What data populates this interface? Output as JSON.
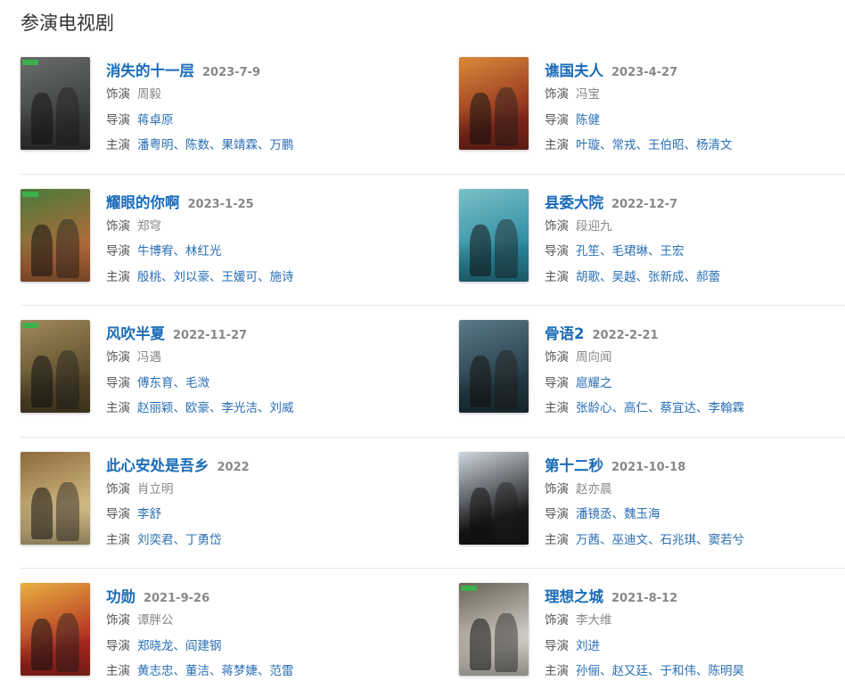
{
  "section_title": "参演电视剧",
  "labels": {
    "role": "饰演",
    "director": "导演",
    "cast": "主演"
  },
  "colors": {
    "title_link": "#1a6cb8",
    "person_link": "#2a6fb5",
    "date": "#888888",
    "divider": "#e8e8e8"
  },
  "shows": [
    {
      "title": "消失的十一层",
      "date": "2023-7-9",
      "role": "周毅",
      "directors": [
        "蒋卓原"
      ],
      "cast": [
        "潘粤明",
        "陈数",
        "果靖霖",
        "万鹏"
      ],
      "poster": {
        "bg": "#3a3d3c",
        "accent": "#6a6d6a",
        "badge": "#3cb04a"
      }
    },
    {
      "title": "谯国夫人",
      "date": "2023-4-27",
      "role": "冯宝",
      "directors": [
        "陈健"
      ],
      "cast": [
        "叶璇",
        "常戎",
        "王伯昭",
        "杨清文"
      ],
      "poster": {
        "bg": "#8a2a1c",
        "accent": "#d98a3a",
        "badge": ""
      }
    },
    {
      "title": "耀眼的你啊",
      "date": "2023-1-25",
      "role": "郑穹",
      "directors": [
        "牛博宥",
        "林红光"
      ],
      "cast": [
        "殷桃",
        "刘以豪",
        "王媛可",
        "施诗"
      ],
      "poster": {
        "bg": "#b46a3a",
        "accent": "#4a7a3a",
        "badge": "#3cb04a"
      }
    },
    {
      "title": "县委大院",
      "date": "2022-12-7",
      "role": "段迎九",
      "directors": [
        "孔笙",
        "毛珺琳",
        "王宏"
      ],
      "cast": [
        "胡歌",
        "吴越",
        "张新成",
        "郝蕾"
      ],
      "poster": {
        "bg": "#2a8aa0",
        "accent": "#7ac0c8",
        "badge": ""
      }
    },
    {
      "title": "风吹半夏",
      "date": "2022-11-27",
      "role": "冯遇",
      "directors": [
        "傅东育",
        "毛溦"
      ],
      "cast": [
        "赵丽颖",
        "欧豪",
        "李光洁",
        "刘威"
      ],
      "poster": {
        "bg": "#5a4a2a",
        "accent": "#a08a5a",
        "badge": "#3cb04a"
      }
    },
    {
      "title": "骨语2",
      "date": "2022-2-21",
      "role": "周向闻",
      "directors": [
        "扈耀之"
      ],
      "cast": [
        "张龄心",
        "高仁",
        "蔡宜达",
        "李翰霖"
      ],
      "poster": {
        "bg": "#243a44",
        "accent": "#5a7a88",
        "badge": ""
      }
    },
    {
      "title": "此心安处是吾乡",
      "date": "2022",
      "role": "肖立明",
      "directors": [
        "李舒"
      ],
      "cast": [
        "刘奕君",
        "丁勇岱"
      ],
      "poster": {
        "bg": "#d8c088",
        "accent": "#8a6a3a",
        "badge": ""
      }
    },
    {
      "title": "第十二秒",
      "date": "2021-10-18",
      "role": "赵亦晨",
      "directors": [
        "潘镜丞",
        "魏玉海"
      ],
      "cast": [
        "万茜",
        "巫迪文",
        "石兆琪",
        "窦若兮"
      ],
      "poster": {
        "bg": "#1a1a1a",
        "accent": "#cfd6e0",
        "badge": ""
      }
    },
    {
      "title": "功勋",
      "date": "2021-9-26",
      "role": "谭胖公",
      "directors": [
        "郑晓龙",
        "阎建钢"
      ],
      "cast": [
        "黄志忠",
        "董洁",
        "蒋梦婕",
        "范雷"
      ],
      "poster": {
        "bg": "#b02a22",
        "accent": "#e8b040",
        "badge": ""
      }
    },
    {
      "title": "理想之城",
      "date": "2021-8-12",
      "role": "李大维",
      "directors": [
        "刘进"
      ],
      "cast": [
        "孙俪",
        "赵又廷",
        "于和伟",
        "陈明昊"
      ],
      "poster": {
        "bg": "#d8d4cc",
        "accent": "#6a6258",
        "badge": "#3cb04a"
      }
    }
  ]
}
